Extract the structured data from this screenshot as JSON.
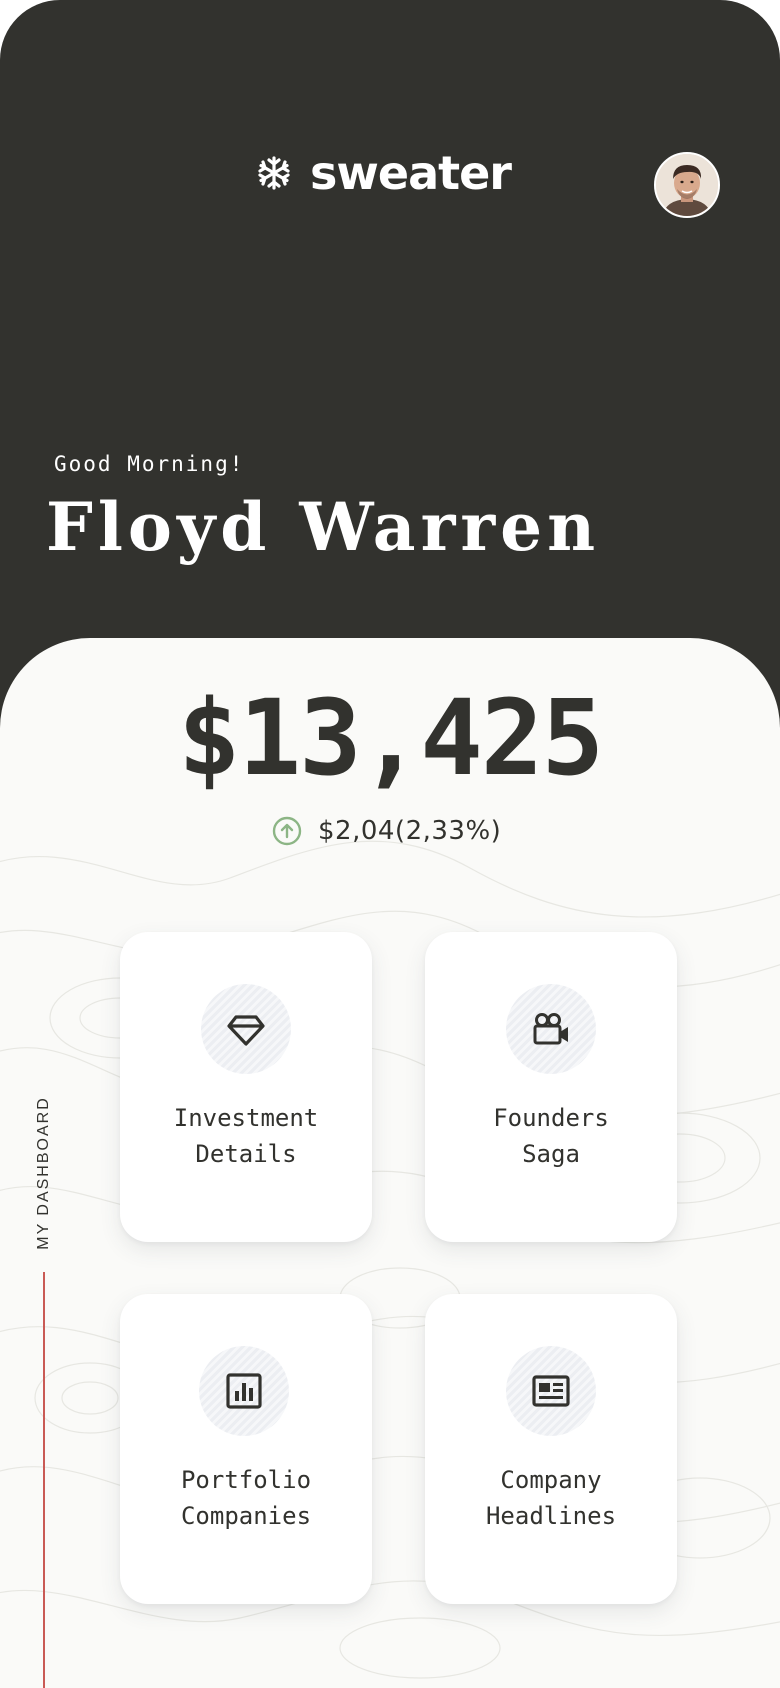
{
  "header": {
    "brand_name": "sweater",
    "brand_icon": "snowflake-icon",
    "avatar": "user-avatar"
  },
  "greeting": "Good Morning!",
  "user_name": "Floyd Warren",
  "balance": {
    "amount": "$13,425",
    "change": "$2,04(2,33%)",
    "change_icon": "arrow-up-circle-icon",
    "change_color": "#8cb585"
  },
  "side_label": "MY DASHBOARD",
  "cards": [
    {
      "label": "Investment\nDetails",
      "icon": "diamond-icon"
    },
    {
      "label": "Founders\nSaga",
      "icon": "video-camera-icon"
    },
    {
      "label": "Portfolio\nCompanies",
      "icon": "bar-chart-icon"
    },
    {
      "label": "Company\nHeadlines",
      "icon": "newspaper-icon"
    }
  ],
  "colors": {
    "header_bg": "#32322e",
    "panel_bg": "#fafaf8",
    "accent_line": "#c95a55",
    "text": "#32322e"
  }
}
